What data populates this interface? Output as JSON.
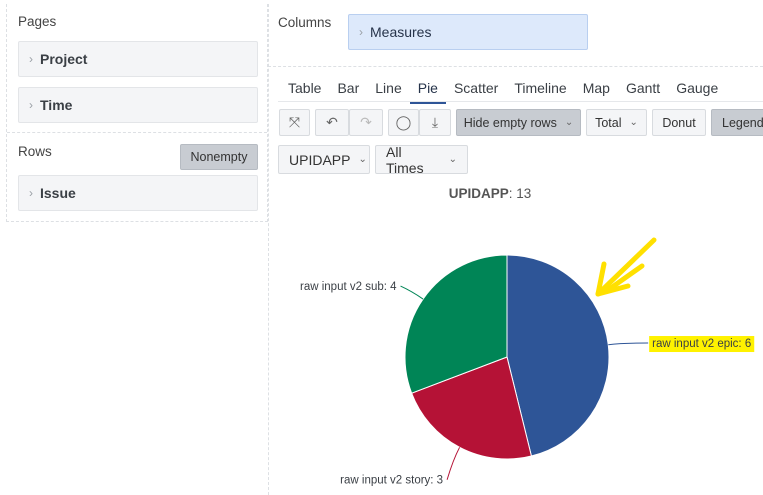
{
  "pages": {
    "title": "Pages",
    "items": [
      "Project",
      "Time"
    ]
  },
  "rows": {
    "title": "Rows",
    "nonempty_label": "Nonempty",
    "items": [
      "Issue"
    ]
  },
  "columns": {
    "title": "Columns",
    "item": "Measures"
  },
  "tabs": [
    "Table",
    "Bar",
    "Line",
    "Pie",
    "Scatter",
    "Timeline",
    "Map",
    "Gantt",
    "Gauge"
  ],
  "active_tab": "Pie",
  "toolbar": {
    "icons": [
      "expand-icon",
      "undo-icon",
      "redo-icon",
      "comment-icon",
      "download-icon"
    ],
    "hide_empty_rows": "Hide empty rows",
    "total": "Total",
    "donut": "Donut",
    "legend": "Legend"
  },
  "selectors": {
    "page_project": "UPIDAPP",
    "page_time": "All Times"
  },
  "chart_title": {
    "name": "UPIDAPP",
    "value": ": 13"
  },
  "chart_data": {
    "type": "pie",
    "title": "UPIDAPP: 13",
    "labels": [
      "raw input v2 epic",
      "raw input v2 story",
      "raw input v2 sub"
    ],
    "values": [
      6,
      3,
      4
    ],
    "colors": [
      "#2e5597",
      "#b51236",
      "#008556"
    ],
    "data_labels": [
      "raw input v2 epic: 6",
      "raw input v2 story: 3",
      "raw input v2 sub: 4"
    ]
  },
  "annotation": {
    "highlight_color": "#fff200",
    "arrow_color": "#ffe000"
  }
}
